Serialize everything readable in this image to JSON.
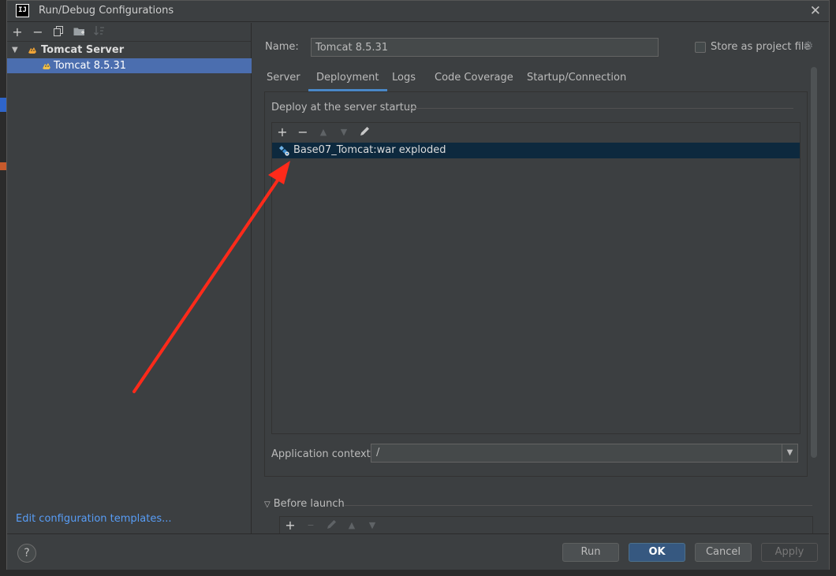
{
  "window": {
    "title": "Run/Debug Configurations",
    "app_icon_text": "IJ",
    "close_glyph": "✕"
  },
  "left": {
    "toolbar": {
      "add": "+",
      "remove": "−",
      "copy_icon": "copy-icon",
      "folder_icon": "new-folder-icon",
      "sort_icon": "sort-icon"
    },
    "tree": {
      "group_label": "Tomcat Server",
      "item_label": "Tomcat 8.5.31"
    },
    "edit_templates_link": "Edit configuration templates..."
  },
  "right": {
    "name_label": "Name:",
    "name_value": "Tomcat 8.5.31",
    "store_label": "Store as project file",
    "store_checked": false,
    "tabs": [
      "Server",
      "Deployment",
      "Logs",
      "Code Coverage",
      "Startup/Connection"
    ],
    "active_tab": "Deployment",
    "deploy_section_title": "Deploy at the server startup",
    "artifact_toolbar": {
      "add": "+",
      "remove": "−",
      "up": "▲",
      "down": "▼",
      "edit_icon": "pencil-icon"
    },
    "artifacts": [
      "Base07_Tomcat:war exploded"
    ],
    "app_context_label": "Application context:",
    "app_context_value": "/",
    "before_launch_label": "Before launch",
    "before_launch_toolbar": {
      "add": "+",
      "remove": "−",
      "up": "▲",
      "down": "▼",
      "edit_icon": "pencil-icon"
    }
  },
  "buttons": {
    "help": "?",
    "run": "Run",
    "ok": "OK",
    "cancel": "Cancel",
    "apply": "Apply"
  },
  "colors": {
    "dialog_bg": "#3c3f41",
    "selection": "#4b6eaf",
    "artifact_selection": "#0d293e",
    "link": "#589df6",
    "primary_button": "#365880",
    "annotation_arrow": "#ff2a1a"
  }
}
